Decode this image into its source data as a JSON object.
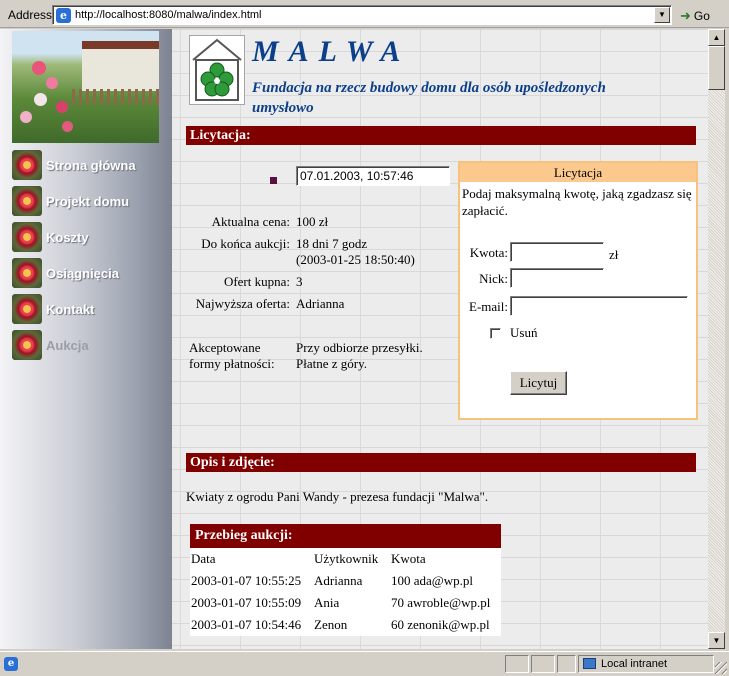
{
  "address_bar": {
    "label": "Address",
    "url": "http://localhost:8080/malwa/index.html",
    "go_label": "Go"
  },
  "sidebar": {
    "items": [
      {
        "label": "Strona główna",
        "active": false
      },
      {
        "label": "Projekt domu",
        "active": false
      },
      {
        "label": "Koszty",
        "active": false
      },
      {
        "label": "Osiągnięcia",
        "active": false
      },
      {
        "label": "Kontakt",
        "active": false
      },
      {
        "label": "Aukcja",
        "active": true
      }
    ]
  },
  "header": {
    "title": "MALWA",
    "subtitle": "Fundacja na rzecz budowy domu dla osób upośledzonych umysłowo"
  },
  "auction": {
    "section_title": "Licytacja:",
    "datetime": "07.01.2003, 10:57:46",
    "current_price_label": "Aktualna cena:",
    "current_price": "100 zł",
    "time_left_label": "Do końca aukcji:",
    "time_left": "18 dni 7 godz",
    "end_date": "(2003-01-25 18:50:40)",
    "offers_label": "Ofert kupna:",
    "offers": "3",
    "highest_label": "Najwyższa oferta:",
    "highest": "Adrianna",
    "payment_label_1": "Akceptowane",
    "payment_label_2": "formy płatności:",
    "payment_1": "Przy odbiorze przesyłki.",
    "payment_2": "Płatne z góry."
  },
  "bid_panel": {
    "title": "Licytacja",
    "intro": "Podaj maksymalną kwotę, jaką zgadzasz się zapłacić.",
    "amount_label": "Kwota:",
    "amount_value": "",
    "currency": "zł",
    "nick_label": "Nick:",
    "nick_value": "",
    "email_label": "E-mail:",
    "email_value": "",
    "remove_label": "Usuń",
    "remove_checked": false,
    "submit_label": "Licytuj"
  },
  "description": {
    "section_title": "Opis i zdjęcie:",
    "text": "Kwiaty z ogrodu Pani Wandy - prezesa fundacji \"Malwa\"."
  },
  "history": {
    "title": "Przebieg aukcji:",
    "columns": [
      "Data",
      "Użytkownik",
      "Kwota"
    ],
    "rows": [
      {
        "date": "2003-01-07 10:55:25",
        "user": "Adrianna",
        "amount": "100 ada@wp.pl"
      },
      {
        "date": "2003-01-07 10:55:09",
        "user": "Ania",
        "amount": "70 awroble@wp.pl"
      },
      {
        "date": "2003-01-07 10:54:46",
        "user": "Zenon",
        "amount": "60 zenonik@wp.pl"
      }
    ]
  },
  "status_bar": {
    "zone": "Local intranet"
  },
  "icons": {
    "page_icon": "ie-page-icon",
    "go": "go-arrow-icon",
    "dropdown": "chevron-down-icon",
    "zone": "intranet-icon"
  },
  "colors": {
    "section_bar": "#800000",
    "title_blue": "#0c3f8a",
    "panel_border": "#f7c27c",
    "panel_head": "#fbc98d"
  }
}
